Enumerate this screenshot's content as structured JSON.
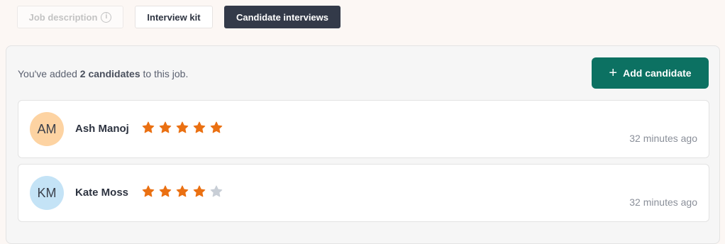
{
  "tabs": [
    {
      "label": "Job description",
      "state": "disabled"
    },
    {
      "label": "Interview kit",
      "state": "default"
    },
    {
      "label": "Candidate interviews",
      "state": "active"
    }
  ],
  "info_icon_glyph": "i",
  "summary": {
    "prefix": "You've added ",
    "count": "2 candidates",
    "suffix": " to this job."
  },
  "add_button": {
    "icon": "plus-icon",
    "glyph": "+",
    "label": "Add candidate",
    "color": "#0c7162"
  },
  "rating_max": 5,
  "colors": {
    "star_filled": "#ea7012",
    "star_empty": "#c8ced6"
  },
  "candidates": [
    {
      "initials": "AM",
      "name": "Ash Manoj",
      "rating": 5,
      "time": "32 minutes ago",
      "avatar_color": "#fdd3a2"
    },
    {
      "initials": "KM",
      "name": "Kate Moss",
      "rating": 4,
      "time": "32 minutes ago",
      "avatar_color": "#c4e3f6"
    }
  ]
}
